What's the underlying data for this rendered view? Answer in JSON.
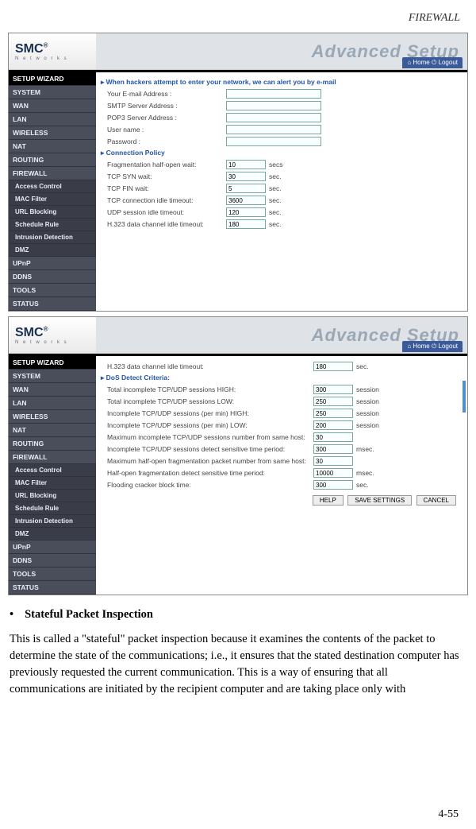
{
  "page_header": "FIREWALL",
  "page_number": "4-55",
  "bullet_heading": "Stateful Packet Inspection",
  "paragraph": "This is called a \"stateful\" packet inspection because it examines the contents of the packet to determine the state of the communications; i.e., it ensures that the stated destination computer has previously requested the current communication. This is a way of ensuring that all communications are initiated by the recipient computer and are taking place only with",
  "brand": {
    "name": "SMC",
    "reg": "®",
    "sub": "N e t w o r k s"
  },
  "banner_text": "Advanced Setup",
  "home_label": "Home",
  "logout_label": "Logout",
  "sidebar_items": [
    {
      "label": "SETUP WIZARD",
      "cls": "setup-wiz"
    },
    {
      "label": "SYSTEM"
    },
    {
      "label": "WAN"
    },
    {
      "label": "LAN"
    },
    {
      "label": "WIRELESS"
    },
    {
      "label": "NAT"
    },
    {
      "label": "ROUTING"
    },
    {
      "label": "FIREWALL"
    },
    {
      "label": "Access Control",
      "cls": "sub"
    },
    {
      "label": "MAC Filter",
      "cls": "sub"
    },
    {
      "label": "URL Blocking",
      "cls": "sub"
    },
    {
      "label": "Schedule Rule",
      "cls": "sub"
    },
    {
      "label": "Intrusion Detection",
      "cls": "sub"
    },
    {
      "label": "DMZ",
      "cls": "sub"
    },
    {
      "label": "UPnP"
    },
    {
      "label": "DDNS"
    },
    {
      "label": "TOOLS"
    },
    {
      "label": "STATUS"
    }
  ],
  "ss1": {
    "intro": "When hackers attempt to enter your network, we can alert you by e-mail",
    "rows_email": [
      {
        "label": "Your E-mail Address :",
        "value": ""
      },
      {
        "label": "SMTP Server Address :",
        "value": ""
      },
      {
        "label": "POP3 Server Address :",
        "value": ""
      },
      {
        "label": "User name :",
        "value": ""
      },
      {
        "label": "Password :",
        "value": ""
      }
    ],
    "conn_policy_h": "Connection Policy",
    "rows_conn": [
      {
        "label": "Fragmentation half-open wait:",
        "value": "10",
        "suffix": "secs"
      },
      {
        "label": "TCP SYN wait:",
        "value": "30",
        "suffix": "sec."
      },
      {
        "label": "TCP FIN wait:",
        "value": "5",
        "suffix": "sec."
      },
      {
        "label": "TCP connection idle timeout:",
        "value": "3600",
        "suffix": "sec."
      },
      {
        "label": "UDP session idle timeout:",
        "value": "120",
        "suffix": "sec."
      },
      {
        "label": "H.323 data channel idle timeout:",
        "value": "180",
        "suffix": "sec."
      }
    ]
  },
  "ss2": {
    "top_row": {
      "label": "H.323 data channel idle timeout:",
      "value": "180",
      "suffix": "sec."
    },
    "dos_h": "DoS Detect Criteria:",
    "rows": [
      {
        "label": "Total incomplete TCP/UDP sessions HIGH:",
        "value": "300",
        "suffix": "session"
      },
      {
        "label": "Total incomplete TCP/UDP sessions LOW:",
        "value": "250",
        "suffix": "session"
      },
      {
        "label": "Incomplete TCP/UDP sessions (per min) HIGH:",
        "value": "250",
        "suffix": "session"
      },
      {
        "label": "Incomplete TCP/UDP sessions (per min) LOW:",
        "value": "200",
        "suffix": "session"
      },
      {
        "label": "Maximum incomplete TCP/UDP sessions number from same host:",
        "value": "30",
        "suffix": ""
      },
      {
        "label": "Incomplete TCP/UDP sessions detect sensitive time period:",
        "value": "300",
        "suffix": "msec."
      },
      {
        "label": "Maximum half-open fragmentation packet number from same host:",
        "value": "30",
        "suffix": ""
      },
      {
        "label": "Half-open fragmentation detect sensitive time period:",
        "value": "10000",
        "suffix": "msec."
      },
      {
        "label": "Flooding cracker block time:",
        "value": "300",
        "suffix": "sec."
      }
    ],
    "buttons": {
      "help": "HELP",
      "save": "SAVE SETTINGS",
      "cancel": "CANCEL"
    }
  }
}
